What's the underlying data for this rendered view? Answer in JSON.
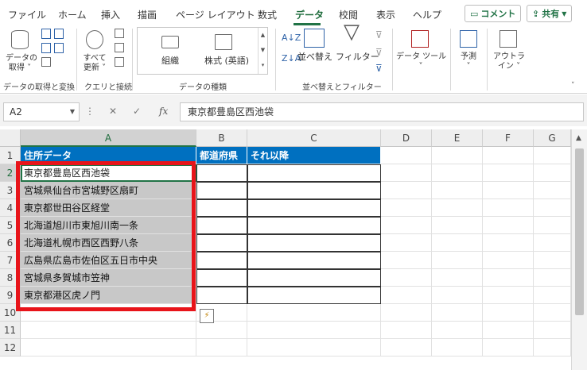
{
  "tabs": [
    {
      "label": "ファイル",
      "active": false
    },
    {
      "label": "ホーム",
      "active": false
    },
    {
      "label": "挿入",
      "active": false
    },
    {
      "label": "描画",
      "active": false
    },
    {
      "label": "ページ レイアウト",
      "active": false
    },
    {
      "label": "数式",
      "active": false
    },
    {
      "label": "データ",
      "active": true
    },
    {
      "label": "校閲",
      "active": false
    },
    {
      "label": "表示",
      "active": false
    },
    {
      "label": "ヘルプ",
      "active": false
    }
  ],
  "top_buttons": {
    "comment": "コメント",
    "share": "共有"
  },
  "ribbon": {
    "get_data": {
      "label1": "データの",
      "label2": "取得 ˅"
    },
    "refresh": {
      "label1": "すべて",
      "label2": "更新 ˅"
    },
    "datatypes": {
      "org": "組織",
      "stock": "株式 (英語)"
    },
    "sort": "並べ替え",
    "filter": "フィルター",
    "datatools": {
      "label1": "データ ツール",
      "label2": "˅"
    },
    "forecast": {
      "label1": "予測",
      "label2": "˅"
    },
    "outline": {
      "label1": "アウトラ",
      "label2": "イン ˅"
    },
    "groups": {
      "get_transform": "データの取得と変換",
      "queries": "クエリと接続",
      "data_types": "データの種類",
      "sort_filter": "並べ替えとフィルター"
    }
  },
  "formula_bar": {
    "name_box": "A2",
    "cancel": "✕",
    "enter": "✓",
    "fx": "fx",
    "value": "東京都豊島区西池袋"
  },
  "columns": [
    "A",
    "B",
    "C",
    "D",
    "E",
    "F",
    "G"
  ],
  "rows": [
    "1",
    "2",
    "3",
    "4",
    "5",
    "6",
    "7",
    "8",
    "9",
    "10",
    "11",
    "12"
  ],
  "headers": {
    "a": "住所データ",
    "b": "都道府県",
    "c": "それ以降"
  },
  "addresses": [
    "東京都豊島区西池袋",
    "宮城県仙台市宮城野区扇町",
    "東京都世田谷区経堂",
    "北海道旭川市東旭川南一条",
    "北海道札幌市西区西野八条",
    "広島県広島市佐伯区五日市中央",
    "宮城県多賀城市笠神",
    "東京都港区虎ノ門"
  ],
  "selected_cell": "A2",
  "colors": {
    "accent": "#217346",
    "header_fill": "#0070c0",
    "data_fill": "#c8c8c8",
    "highlight_frame": "#e8141a"
  }
}
